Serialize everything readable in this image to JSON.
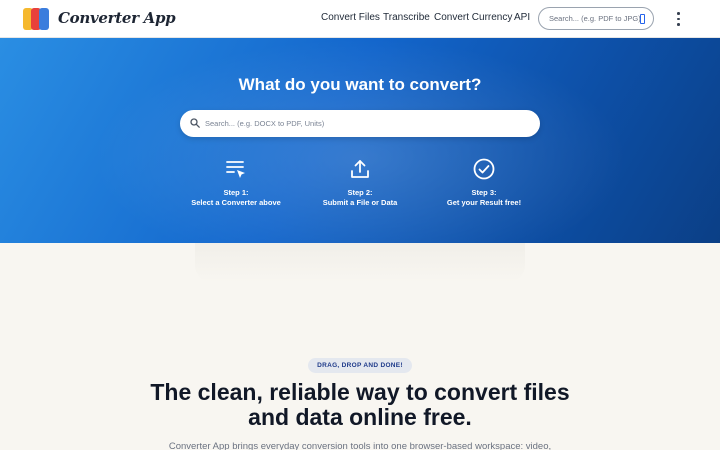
{
  "header": {
    "brand": "Converter App",
    "nav": [
      "Convert Files",
      "Transcribe",
      "Convert Currency",
      "API"
    ],
    "search_placeholder": "Search... (e.g. PDF to JPG)"
  },
  "hero": {
    "title": "What do you want to convert?",
    "search_placeholder": "Search... (e.g. DOCX to PDF, Units)",
    "steps": [
      {
        "title": "Step 1:",
        "subtitle": "Select a Converter above",
        "icon": "list-select-icon"
      },
      {
        "title": "Step 2:",
        "subtitle": "Submit a File or Data",
        "icon": "upload-icon"
      },
      {
        "title": "Step 3:",
        "subtitle": "Get your Result free!",
        "icon": "check-circle-icon"
      }
    ]
  },
  "section": {
    "badge": "DRAG, DROP AND DONE!",
    "headline_line1": "The clean, reliable way to convert files",
    "headline_line2": "and data online free.",
    "lead": "Converter App brings everyday conversion tools into one browser-based workspace: video,"
  },
  "colors": {
    "hero_start": "#2a8ee3",
    "hero_end": "#0b3f86",
    "accent": "#2563eb",
    "page_bg": "#f8f6f1"
  }
}
